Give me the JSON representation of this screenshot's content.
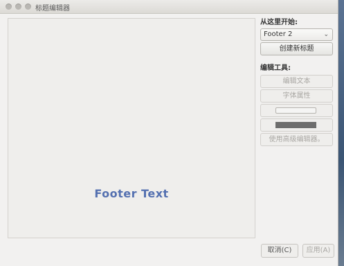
{
  "window": {
    "title": "标题编辑器"
  },
  "canvas": {
    "preview_text": "Footer Text",
    "preview_color": "#5470b0"
  },
  "sidebar": {
    "start_label": "从这里开始:",
    "template_select": {
      "selected": "Footer 2",
      "chevron": "⌄"
    },
    "create_button": "创建新标题",
    "tools_label": "编辑工具:",
    "edit_text_button": "编辑文本",
    "font_props_button": "字体属性",
    "advanced_editor_button": "使用高级编辑器。"
  },
  "colors": {
    "swatch_fill": "#f5f5f4",
    "swatch_outline": "#6d6d6d"
  },
  "dialog_buttons": {
    "cancel": "取消(C)",
    "apply": "应用(A)"
  }
}
